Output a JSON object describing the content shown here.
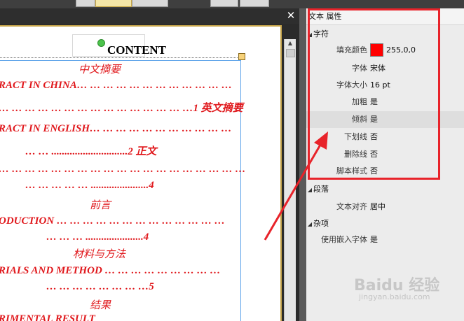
{
  "document": {
    "close_glyph": "✕",
    "heading": "CONTENT",
    "toc_lines": [
      "中文摘要",
      "RACT IN CHINA… … … … … … … … … … … …",
      "… … … … … … … … … … … … … … …1 英文摘要",
      "RACT IN ENGLISH… … … … … … … … … … …",
      "… … .............................2  正文",
      "… … … … … … … … … … … … … … … … … … …",
      "… … … … … ......................4",
      "前言",
      "ODUCTION … … … … … … … … … … … … …",
      "… … … ......................4",
      "材料与方法",
      "RIALS AND METHOD … … … … … … … … …",
      "… … … … … … … …5",
      "结果",
      "RIMENTAL RESULT"
    ]
  },
  "panel": {
    "title": "文本 属性",
    "sections": {
      "char": "字符",
      "para": "段落",
      "misc": "杂项"
    },
    "char_props": [
      {
        "label": "填充颜色",
        "value": "255,0,0"
      },
      {
        "label": "字体",
        "value": "宋体"
      },
      {
        "label": "字体大小",
        "value": "16 pt"
      },
      {
        "label": "加粗",
        "value": "是"
      },
      {
        "label": "倾斜",
        "value": "是"
      },
      {
        "label": "下划线",
        "value": "否"
      },
      {
        "label": "删除线",
        "value": "否"
      },
      {
        "label": "脚本样式",
        "value": "否"
      }
    ],
    "para_props": [
      {
        "label": "文本对齐",
        "value": "居中"
      }
    ],
    "misc_props": [
      {
        "label": "使用嵌入字体",
        "value": "是"
      }
    ],
    "fill_color": "#ff0000"
  },
  "watermark": {
    "main": "Baidu 经验",
    "sub": "jingyan.baidu.com"
  }
}
